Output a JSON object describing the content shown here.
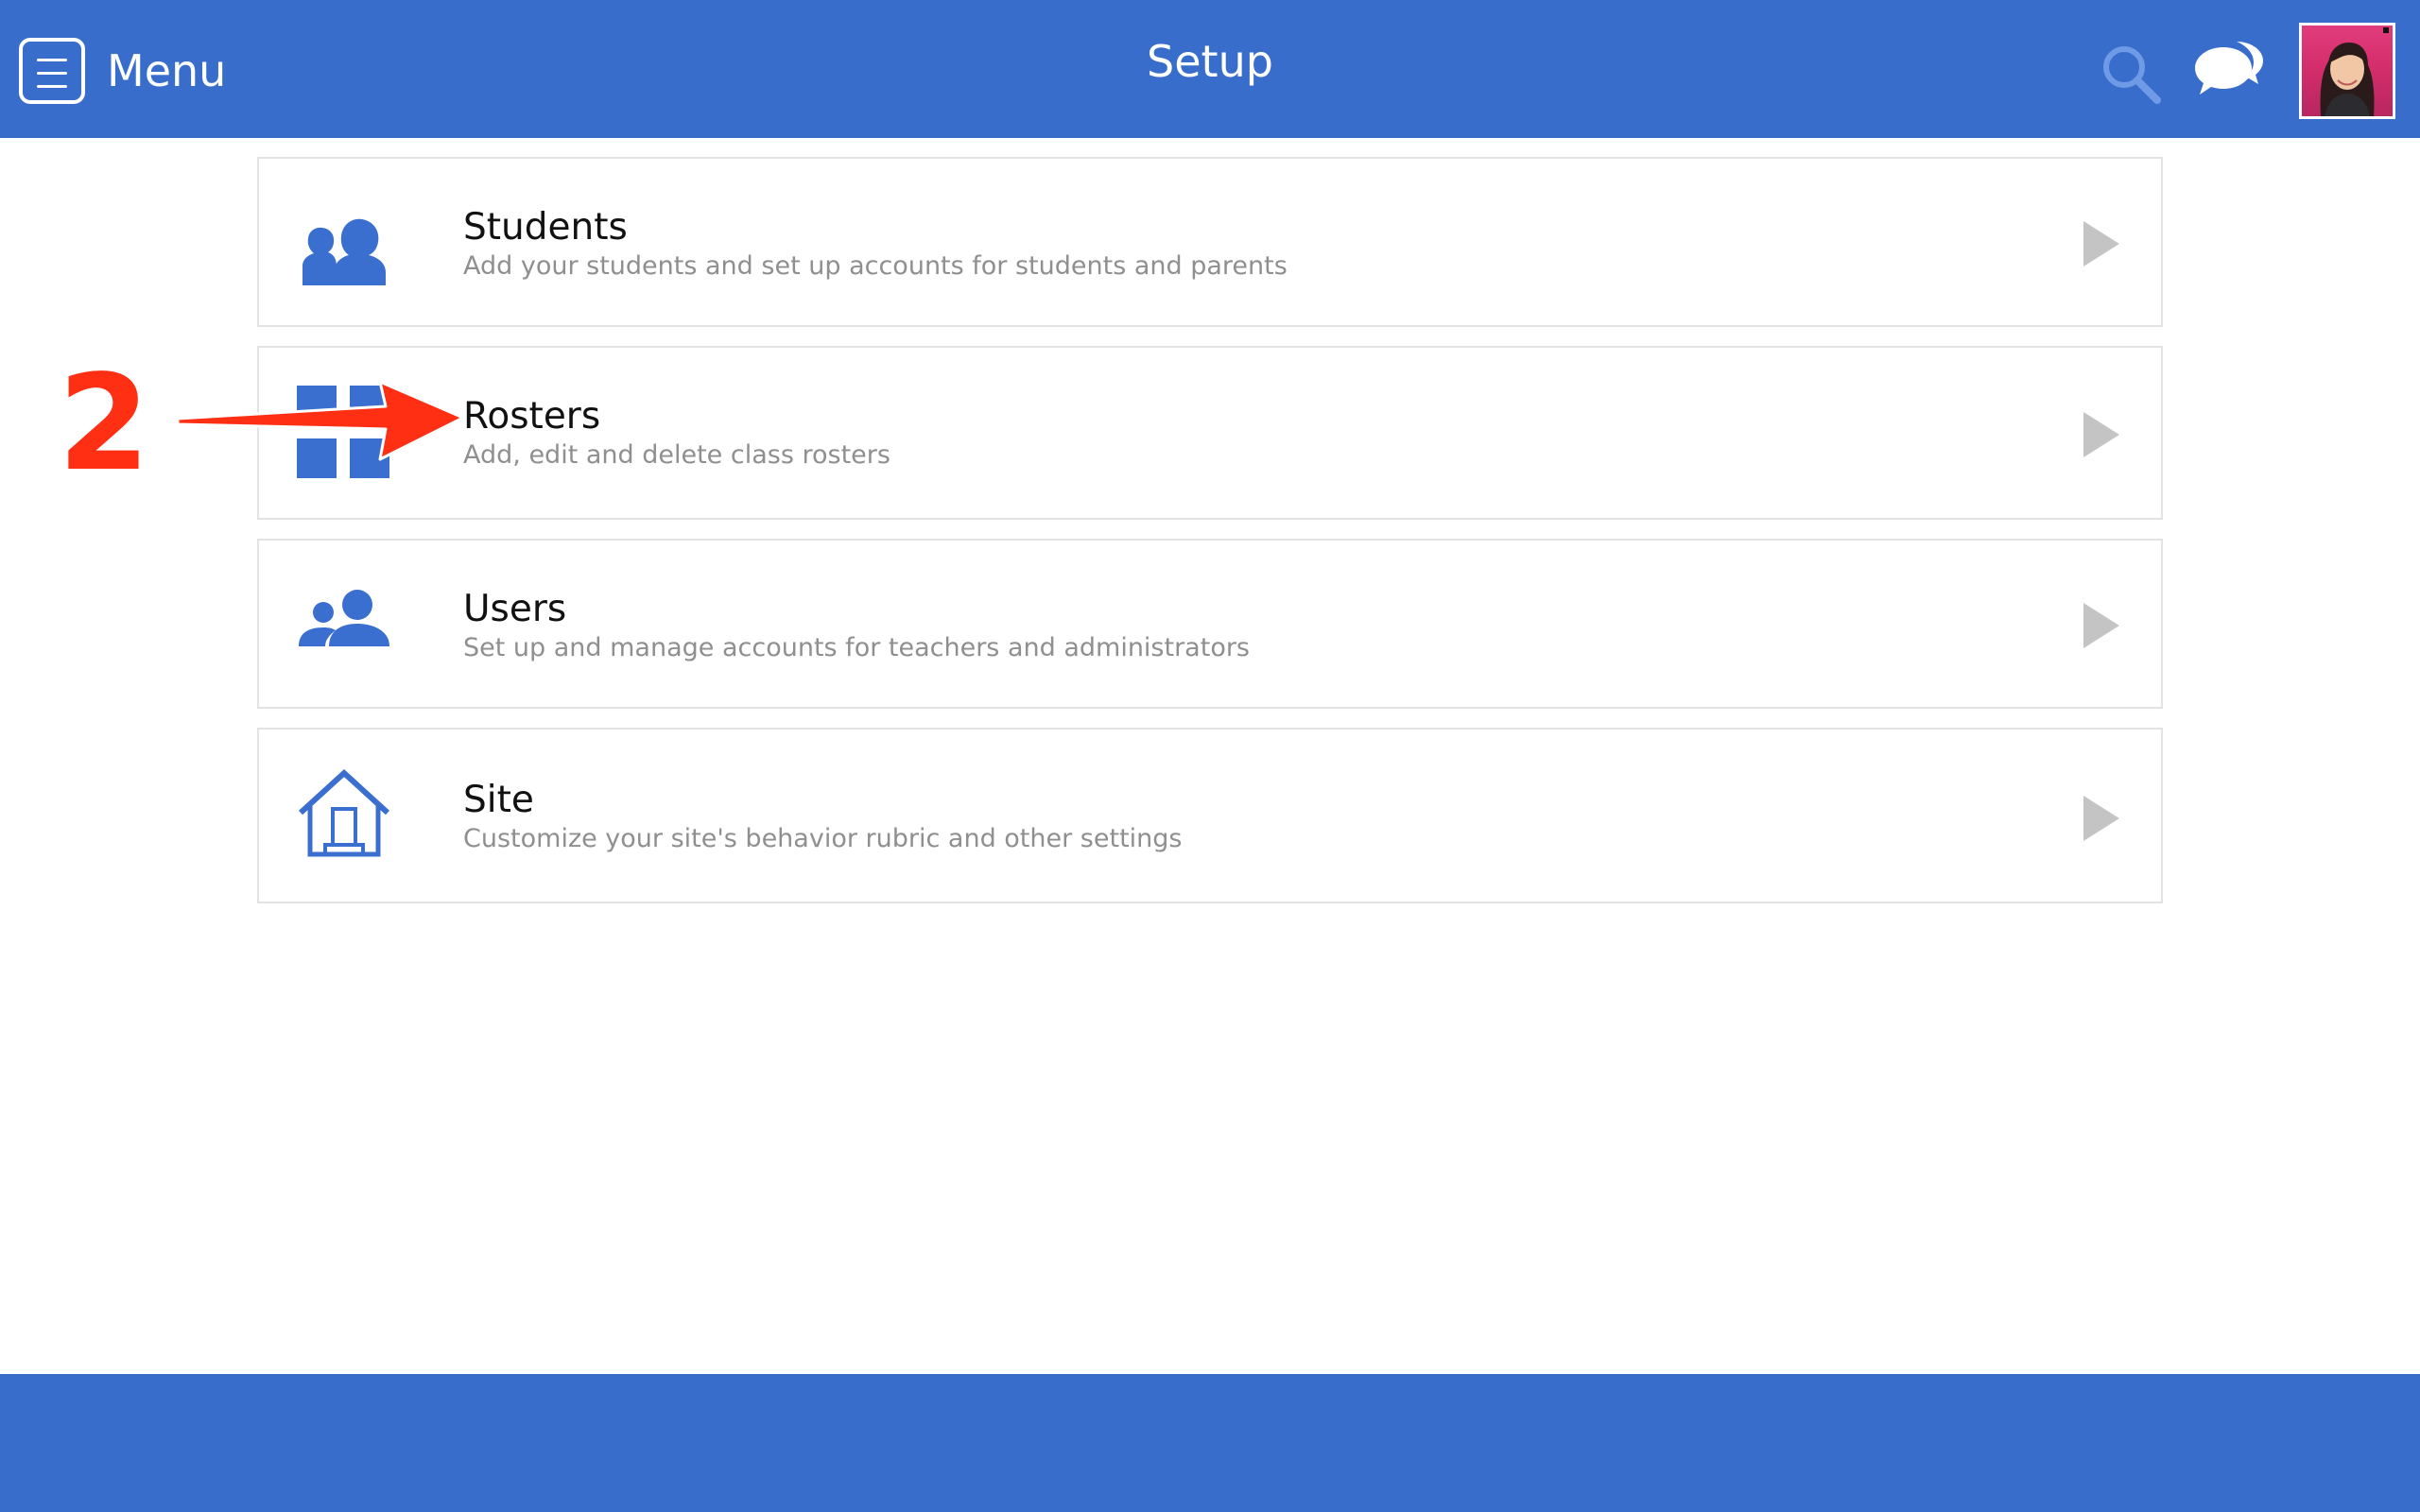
{
  "header": {
    "menu_label": "Menu",
    "title": "Setup",
    "icons": {
      "menu": "hamburger-menu-icon",
      "search": "search-icon",
      "messages": "chat-bubbles-icon",
      "profile": "user-avatar"
    }
  },
  "items": [
    {
      "title": "Students",
      "subtitle": "Add your students and set up accounts for students and parents",
      "icon": "students-icon"
    },
    {
      "title": "Rosters",
      "subtitle": "Add, edit and delete class rosters",
      "icon": "rosters-grid-icon"
    },
    {
      "title": "Users",
      "subtitle": "Set up and manage accounts for teachers and administrators",
      "icon": "users-icon"
    },
    {
      "title": "Site",
      "subtitle": "Customize your site's behavior rubric and other settings",
      "icon": "house-icon"
    }
  ],
  "annotation": {
    "step": "2",
    "color": "#ff2f14"
  },
  "colors": {
    "brand": "#396dcc",
    "icon": "#3a6fd0",
    "subtitle": "#8f8f8f",
    "chevron": "#c4c4c4",
    "border": "#e3e3e3"
  }
}
